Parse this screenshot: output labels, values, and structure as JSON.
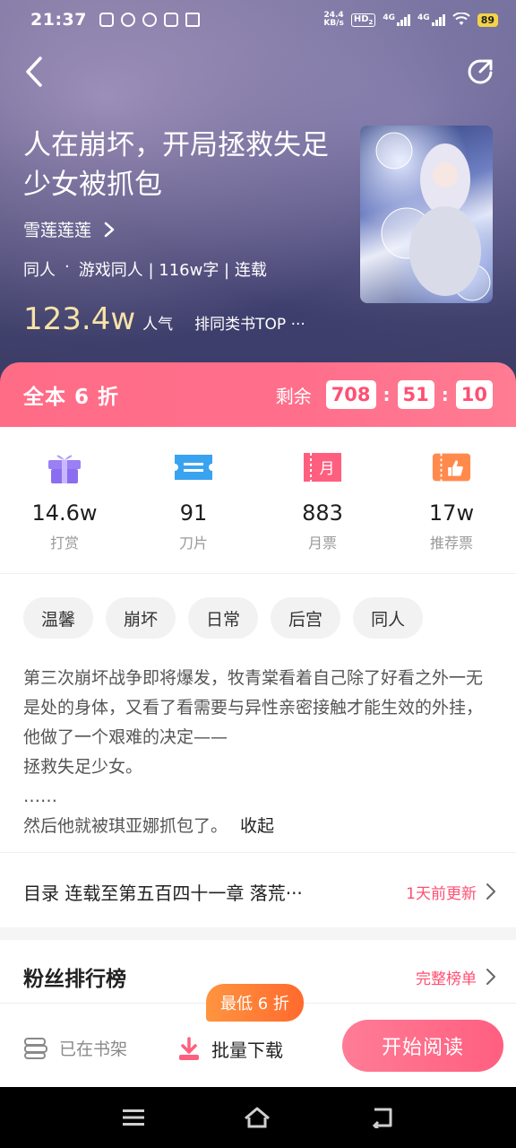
{
  "status_bar": {
    "time": "21:37",
    "net_speed_top": "24.4",
    "net_speed_unit": "KB/s",
    "hd_label": "HD",
    "hd_sub": "2",
    "signal1_label": "4G",
    "signal2_label": "4G",
    "battery": "89"
  },
  "book": {
    "title": "人在崩坏，开局拯救失足少女被抓包",
    "author": "雪莲莲莲",
    "meta": [
      "同人",
      "·",
      "游戏同人 | 116w字 | 连载"
    ],
    "popularity_value": "123.4w",
    "popularity_unit": "人气",
    "rank_text": "排同类书TOP ···"
  },
  "discount": {
    "label": "全本 6 折",
    "remain_label": "剩余",
    "hours": "708",
    "minutes": "51",
    "seconds": "10",
    "colon": ":"
  },
  "stats": [
    {
      "icon": "gift-icon",
      "value": "14.6w",
      "label": "打赏",
      "color": "#8b6ef0"
    },
    {
      "icon": "blade-ticket-icon",
      "value": "91",
      "label": "刀片",
      "color": "#3aa3f0"
    },
    {
      "icon": "monthly-ticket-icon",
      "value": "883",
      "label": "月票",
      "color": "#ff5f7f"
    },
    {
      "icon": "recommend-ticket-icon",
      "value": "17w",
      "label": "推荐票",
      "color": "#ff8a4c"
    }
  ],
  "tags": [
    "温馨",
    "崩坏",
    "日常",
    "后宫",
    "同人"
  ],
  "description": {
    "text": "第三次崩坏战争即将爆发，牧青棠看着自己除了好看之外一无是处的身体，又看了看需要与异性亲密接触才能生效的外挂，他做了一个艰难的决定——\n拯救失足少女。\n……\n然后他就被琪亚娜抓包了。",
    "collapse": "收起"
  },
  "catalog": {
    "title": "目录 连载至第五百四十一章 落荒···",
    "update": "1天前更新"
  },
  "fans": {
    "title": "粉丝排行榜",
    "more": "完整榜单"
  },
  "action_bar": {
    "shelf": "已在书架",
    "download": "批量下载",
    "promo": "最低 6 折",
    "read": "开始阅读"
  },
  "colors": {
    "accent": "#ff5f80",
    "popularity": "#f7e3a8",
    "promo": "#ff7a36"
  }
}
